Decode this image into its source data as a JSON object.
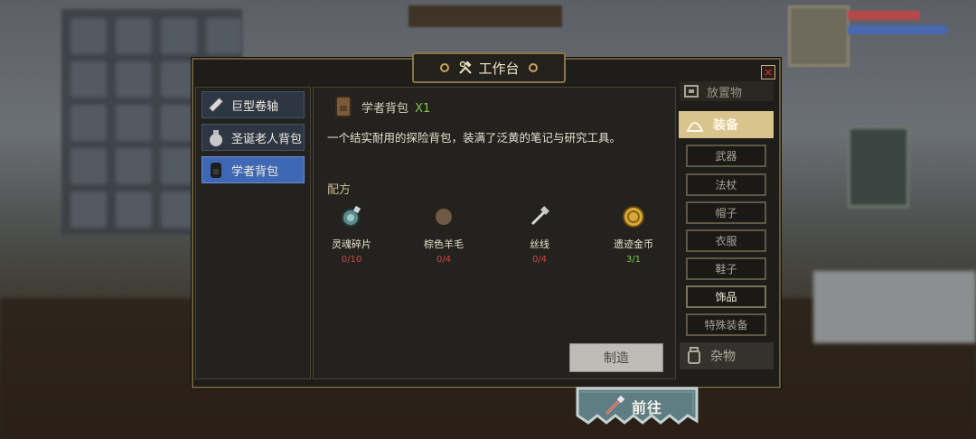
{
  "window": {
    "title": "工作台",
    "close_glyph": "×"
  },
  "item_list": [
    {
      "label": "巨型卷轴",
      "icon": "scroll-icon",
      "active": false
    },
    {
      "label": "圣诞老人背包",
      "icon": "sack-icon",
      "active": false
    },
    {
      "label": "学者背包",
      "icon": "backpack-icon",
      "active": true
    }
  ],
  "detail": {
    "name": "学者背包",
    "quantity": "X1",
    "description": "一个结实耐用的探险背包，装满了泛黄的笔记与研究工具。",
    "recipe_label": "配方",
    "ingredients": [
      {
        "name": "灵魂碎片",
        "count": "0/10",
        "enough": false,
        "icon": "soul-shard-icon"
      },
      {
        "name": "棕色羊毛",
        "count": "0/4",
        "enough": false,
        "icon": "wool-icon"
      },
      {
        "name": "丝线",
        "count": "0/4",
        "enough": false,
        "icon": "thread-icon"
      },
      {
        "name": "遗迹金币",
        "count": "3/1",
        "enough": true,
        "icon": "gold-coin-icon"
      }
    ],
    "craft_label": "制造"
  },
  "categories": {
    "top_label": "放置物",
    "main_label": "装备",
    "sub": [
      "武器",
      "法杖",
      "帽子",
      "衣服",
      "鞋子",
      "饰品",
      "特殊装备"
    ],
    "selected_sub": "饰品",
    "bottom_label": "杂物"
  },
  "go_button": {
    "label": "前往"
  },
  "colors": {
    "accent_gold": "#c9a35a",
    "active_blue": "#3f68b4",
    "missing_red": "#d84040",
    "ok_green": "#7ec850"
  }
}
